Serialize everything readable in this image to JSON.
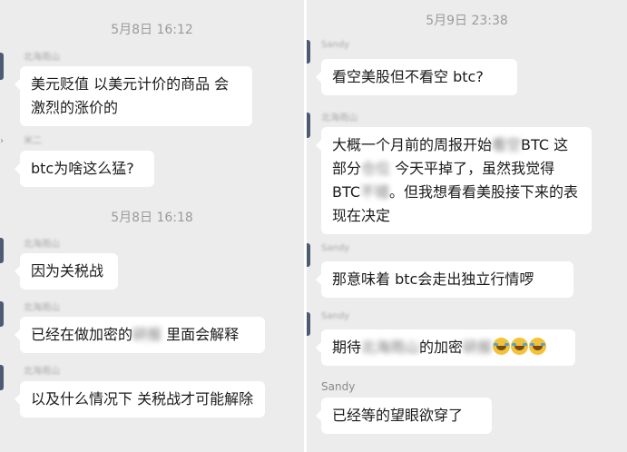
{
  "left": {
    "time1": "5月8日 16:12",
    "sender1": "北海雨山",
    "msg1": "美元贬值 以美元计价的商品 会激烈的涨价的",
    "sender2": "米二",
    "msg2": "btc为啥这么猛?",
    "time2": "5月8日 16:18",
    "sender3": "北海雨山",
    "msg3": "因为关税战",
    "sender4": "北海雨山",
    "msg4_pre": "已经在做加密的",
    "msg4_blur": "研报",
    "msg4_post": " 里面会解释",
    "sender5": "北海雨山",
    "msg5": "以及什么情况下 关税战才可能解除"
  },
  "right": {
    "time1": "5月9日 23:38",
    "sender1": "Sandy",
    "msg1": "看空美股但不看空 btc?",
    "sender2": "北海雨山",
    "msg2_a": "大概一个月前的周报开始",
    "msg2_blur1": "看空",
    "msg2_b": "BTC 这部分",
    "msg2_blur2": "仓位",
    "msg2_c": " 今天平掉了，虽然我觉得BTC",
    "msg2_blur3": "不错",
    "msg2_d": "。但我想看看美股接下来的表现在决定",
    "sender3": "Sandy",
    "msg3": "那意味着 btc会走出独立行情啰",
    "sender4": "Sandy",
    "msg4_pre": "期待",
    "msg4_blur1": "北海雨山",
    "msg4_mid": "的加密",
    "msg4_blur2": "研报",
    "sender5": "Sandy",
    "msg5": "已经等的望眼欲穿了"
  },
  "icons": [
    "crying-laugh-emoji-icon",
    "crying-laugh-emoji-icon",
    "crying-laugh-emoji-icon"
  ],
  "colors": {
    "panel_bg": "#ececec",
    "bubble_bg": "#ffffff",
    "timestamp": "#9b9b9b"
  }
}
